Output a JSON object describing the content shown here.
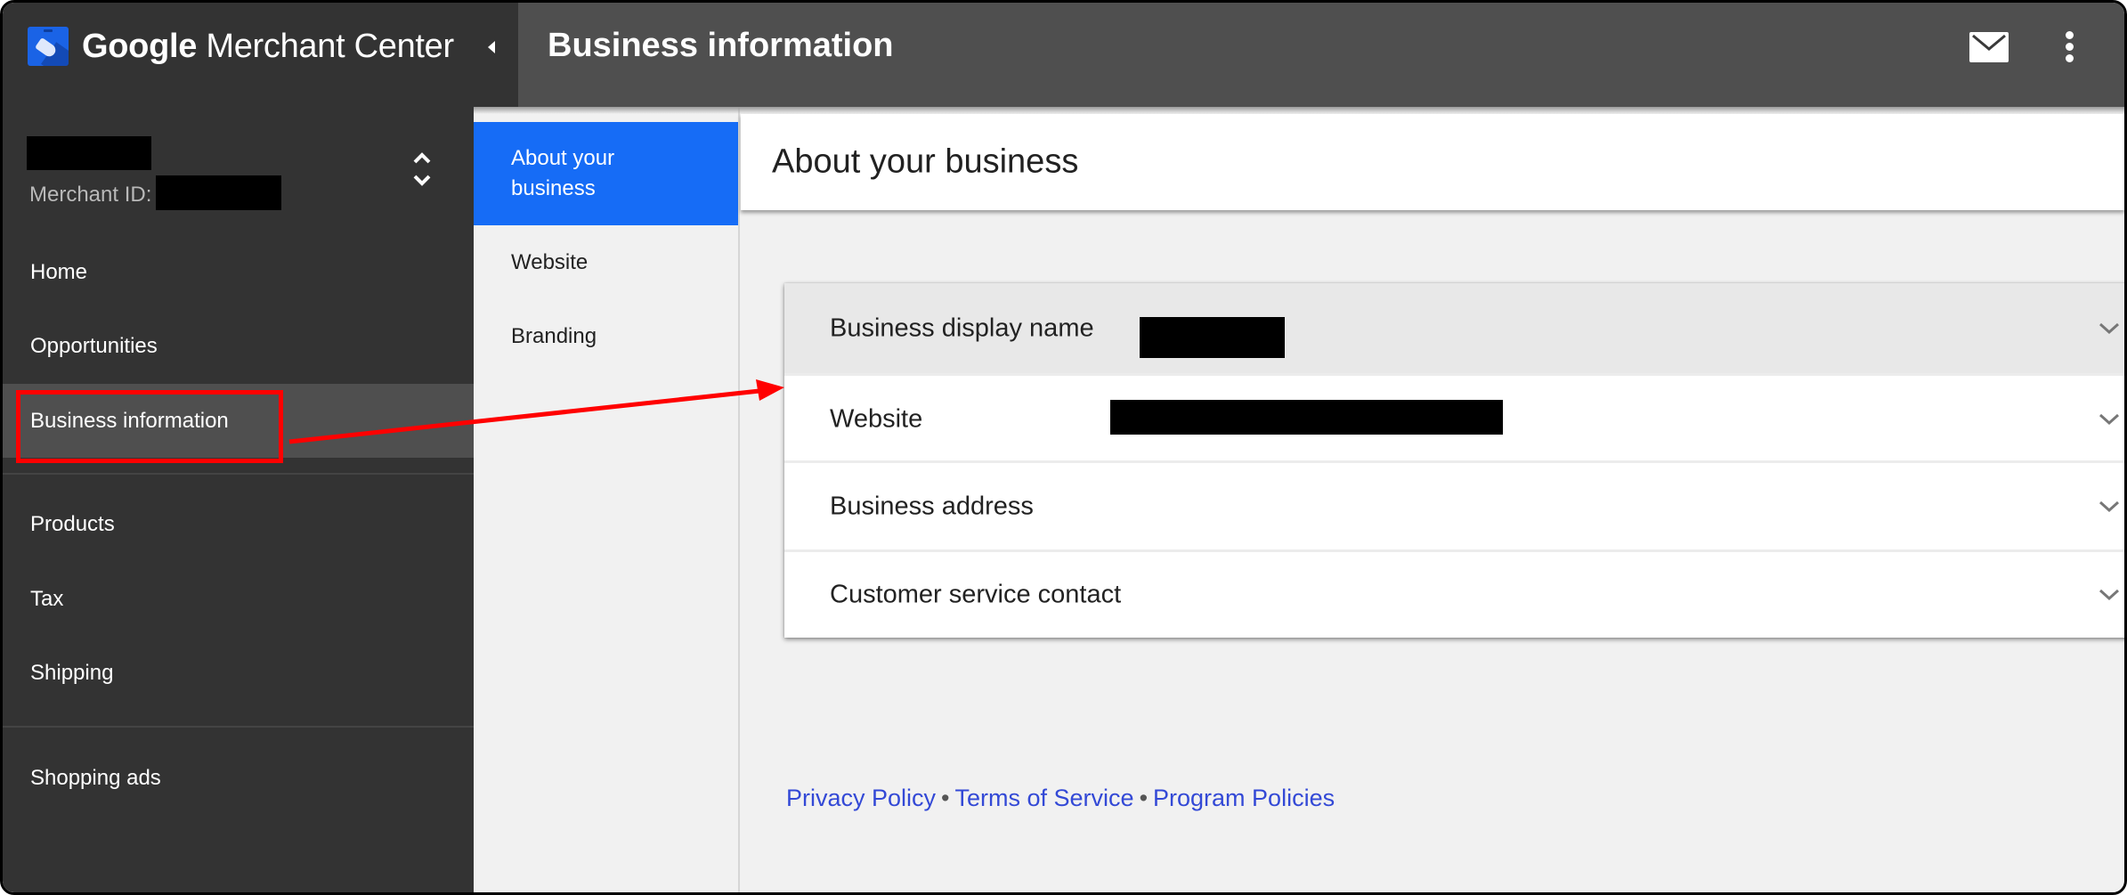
{
  "app": {
    "brand_strong": "Google",
    "brand_rest": " Merchant Center",
    "page_title": "Business information",
    "icons": {
      "logo": "merchant-center-logo",
      "collapse": "caret-left-icon",
      "mail": "mail-icon",
      "more": "more-vert-icon",
      "account_switch": "unfold-more-icon",
      "row_expand": "chevron-down-icon"
    }
  },
  "account": {
    "name": "[redacted]",
    "merchant_id_label": "Merchant ID:",
    "merchant_id_value": "[redacted]"
  },
  "sidebar": {
    "items": [
      {
        "label": "Home",
        "selected": false
      },
      {
        "label": "Opportunities",
        "selected": false
      },
      {
        "label": "Business information",
        "selected": true
      },
      {
        "label": "Products",
        "selected": false
      },
      {
        "label": "Tax",
        "selected": false
      },
      {
        "label": "Shipping",
        "selected": false
      },
      {
        "label": "Shopping ads",
        "selected": false
      }
    ]
  },
  "subnav": {
    "items": [
      {
        "label": "About your business",
        "active": true
      },
      {
        "label": "Website",
        "active": false
      },
      {
        "label": "Branding",
        "active": false
      }
    ]
  },
  "section": {
    "title": "About your business",
    "rows": [
      {
        "label": "Business display name",
        "value": "[redacted]"
      },
      {
        "label": "Website",
        "value": "[redacted]"
      },
      {
        "label": "Business address",
        "value": ""
      },
      {
        "label": "Customer service contact",
        "value": ""
      }
    ]
  },
  "footer": {
    "links": [
      "Privacy Policy",
      "Terms of Service",
      "Program Policies"
    ],
    "separator": "•"
  },
  "annotation": {
    "highlight_target": "Business information",
    "arrow_target": "Business display name",
    "color": "#ff0000"
  },
  "colors": {
    "accent_blue": "#166cf6",
    "sidebar_bg": "#333333",
    "appbar_bg": "#4f4f4f",
    "link": "#3349d6",
    "annotation": "#ff0000"
  }
}
